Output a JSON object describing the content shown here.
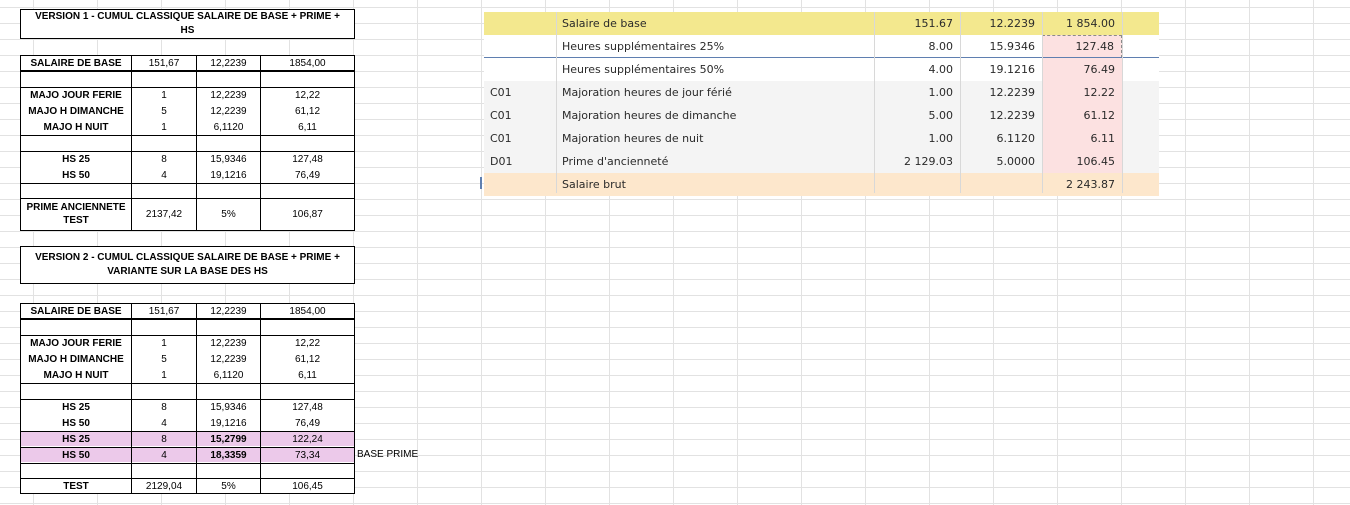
{
  "version1": {
    "title": "VERSION 1 - CUMUL CLASSIQUE SALAIRE DE BASE + PRIME + HS",
    "base": {
      "label": "SALAIRE DE BASE",
      "qty": "151,67",
      "rate": "12,2239",
      "amount": "1854,00"
    },
    "majo": [
      {
        "label": "MAJO JOUR FERIE",
        "qty": "1",
        "rate": "12,2239",
        "amount": "12,22"
      },
      {
        "label": "MAJO H DIMANCHE",
        "qty": "5",
        "rate": "12,2239",
        "amount": "61,12"
      },
      {
        "label": "MAJO H NUIT",
        "qty": "1",
        "rate": "6,1120",
        "amount": "6,11"
      }
    ],
    "hs": [
      {
        "label": "HS 25",
        "qty": "8",
        "rate": "15,9346",
        "amount": "127,48"
      },
      {
        "label": "HS 50",
        "qty": "4",
        "rate": "19,1216",
        "amount": "76,49"
      }
    ],
    "prime": {
      "label": "PRIME ANCIENNETE TEST",
      "base": "2137,42",
      "rate": "5%",
      "amount": "106,87"
    }
  },
  "version2": {
    "title": "VERSION 2 - CUMUL CLASSIQUE SALAIRE DE BASE + PRIME + VARIANTE SUR LA BASE DES HS",
    "base": {
      "label": "SALAIRE DE BASE",
      "qty": "151,67",
      "rate": "12,2239",
      "amount": "1854,00"
    },
    "majo": [
      {
        "label": "MAJO JOUR FERIE",
        "qty": "1",
        "rate": "12,2239",
        "amount": "12,22"
      },
      {
        "label": "MAJO H DIMANCHE",
        "qty": "5",
        "rate": "12,2239",
        "amount": "61,12"
      },
      {
        "label": "MAJO H NUIT",
        "qty": "1",
        "rate": "6,1120",
        "amount": "6,11"
      }
    ],
    "hs": [
      {
        "label": "HS 25",
        "qty": "8",
        "rate": "15,9346",
        "amount": "127,48"
      },
      {
        "label": "HS 50",
        "qty": "4",
        "rate": "19,1216",
        "amount": "76,49"
      },
      {
        "label": "HS 25",
        "qty": "8",
        "rate": "15,2799",
        "amount": "122,24"
      },
      {
        "label": "HS 50",
        "qty": "4",
        "rate": "18,3359",
        "amount": "73,34"
      }
    ],
    "base_prime_note": "BASE PRIME",
    "test": {
      "label": "TEST",
      "base": "2129,04",
      "rate": "5%",
      "amount": "106,45"
    }
  },
  "payslip": {
    "rows": [
      {
        "code": "",
        "label": "Salaire de base",
        "qty": "151.67",
        "rate": "12.2239",
        "amount": "1 854.00"
      },
      {
        "code": "",
        "label": "Heures supplémentaires 25%",
        "qty": "8.00",
        "rate": "15.9346",
        "amount": "127.48"
      },
      {
        "code": "",
        "label": "Heures supplémentaires 50%",
        "qty": "4.00",
        "rate": "19.1216",
        "amount": "76.49"
      },
      {
        "code": "C01",
        "label": "Majoration heures de jour férié",
        "qty": "1.00",
        "rate": "12.2239",
        "amount": "12.22"
      },
      {
        "code": "C01",
        "label": "Majoration heures de dimanche",
        "qty": "5.00",
        "rate": "12.2239",
        "amount": "61.12"
      },
      {
        "code": "C01",
        "label": "Majoration heures de nuit",
        "qty": "1.00",
        "rate": "6.1120",
        "amount": "6.11"
      },
      {
        "code": "D01",
        "label": "Prime d'ancienneté",
        "qty": "2 129.03",
        "rate": "5.0000",
        "amount": "106.45"
      }
    ],
    "total": {
      "label": "Salaire brut",
      "amount": "2 243.87"
    }
  },
  "colors": {
    "highlight_yellow": "#f3e88e",
    "total_peach": "#fde7cc",
    "amount_pink": "#fce1e1",
    "row_pink": "#ecc9ea"
  }
}
